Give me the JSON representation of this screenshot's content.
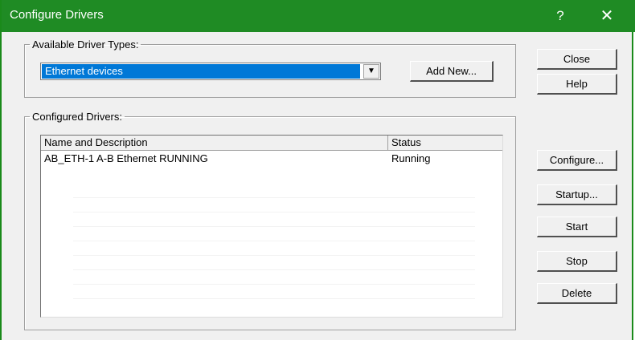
{
  "window": {
    "title": "Configure Drivers",
    "help_glyph": "?",
    "close_glyph": "✕"
  },
  "driver_types": {
    "legend": "Available Driver Types:",
    "selected": "Ethernet devices",
    "dropdown_glyph": "▼",
    "add_new_label": "Add New..."
  },
  "configured": {
    "legend": "Configured Drivers:",
    "columns": [
      "Name and Description",
      "Status"
    ],
    "rows": [
      {
        "name": "AB_ETH-1  A-B Ethernet  RUNNING",
        "status": "Running"
      }
    ]
  },
  "side_buttons": {
    "close": "Close",
    "help": "Help",
    "configure": "Configure...",
    "startup": "Startup...",
    "start": "Start",
    "stop": "Stop",
    "delete": "Delete"
  },
  "colors": {
    "titlebar": "#1f8b24",
    "selection": "#0078d7"
  }
}
